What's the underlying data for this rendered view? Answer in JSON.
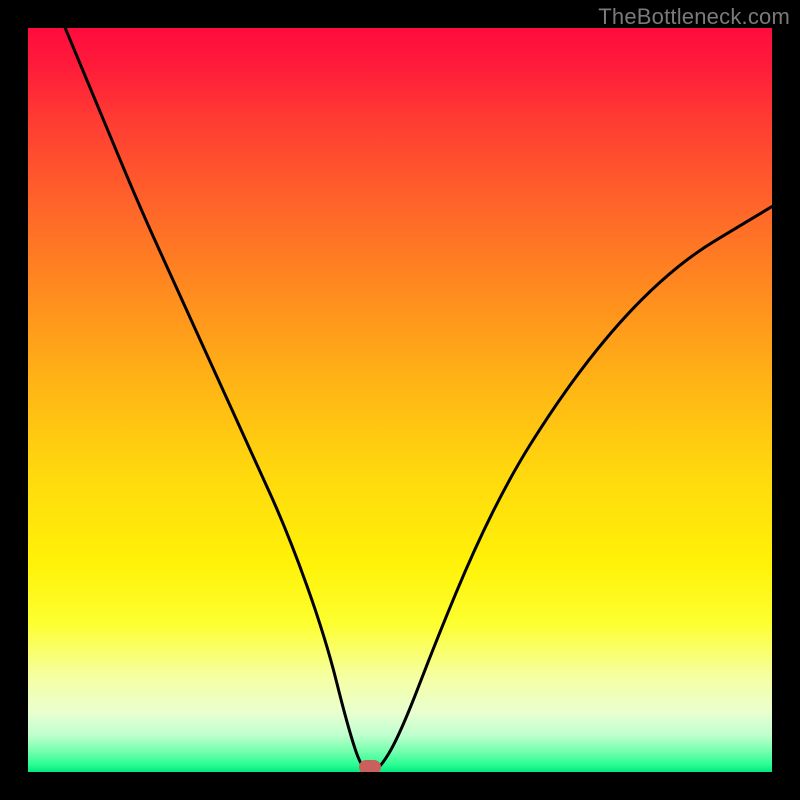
{
  "watermark": "TheBottleneck.com",
  "chart_data": {
    "type": "line",
    "title": "",
    "xlabel": "",
    "ylabel": "",
    "xlim": [
      0,
      100
    ],
    "ylim": [
      0,
      100
    ],
    "series": [
      {
        "name": "curve",
        "x": [
          5,
          10,
          15,
          20,
          25,
          30,
          35,
          40,
          43,
          45,
          47,
          50,
          55,
          60,
          65,
          70,
          75,
          80,
          85,
          90,
          95,
          100
        ],
        "y": [
          100,
          88,
          76,
          65,
          54,
          43,
          32,
          18,
          6,
          0,
          0,
          5,
          18,
          30,
          40,
          48,
          55,
          61,
          66,
          70,
          73,
          76
        ]
      }
    ],
    "marker": {
      "x": 46,
      "y": 0
    },
    "gradient_stops": [
      {
        "pos": 0,
        "color": "#ff0b3e"
      },
      {
        "pos": 50,
        "color": "#ffd400"
      },
      {
        "pos": 100,
        "color": "#05e77f"
      }
    ]
  }
}
